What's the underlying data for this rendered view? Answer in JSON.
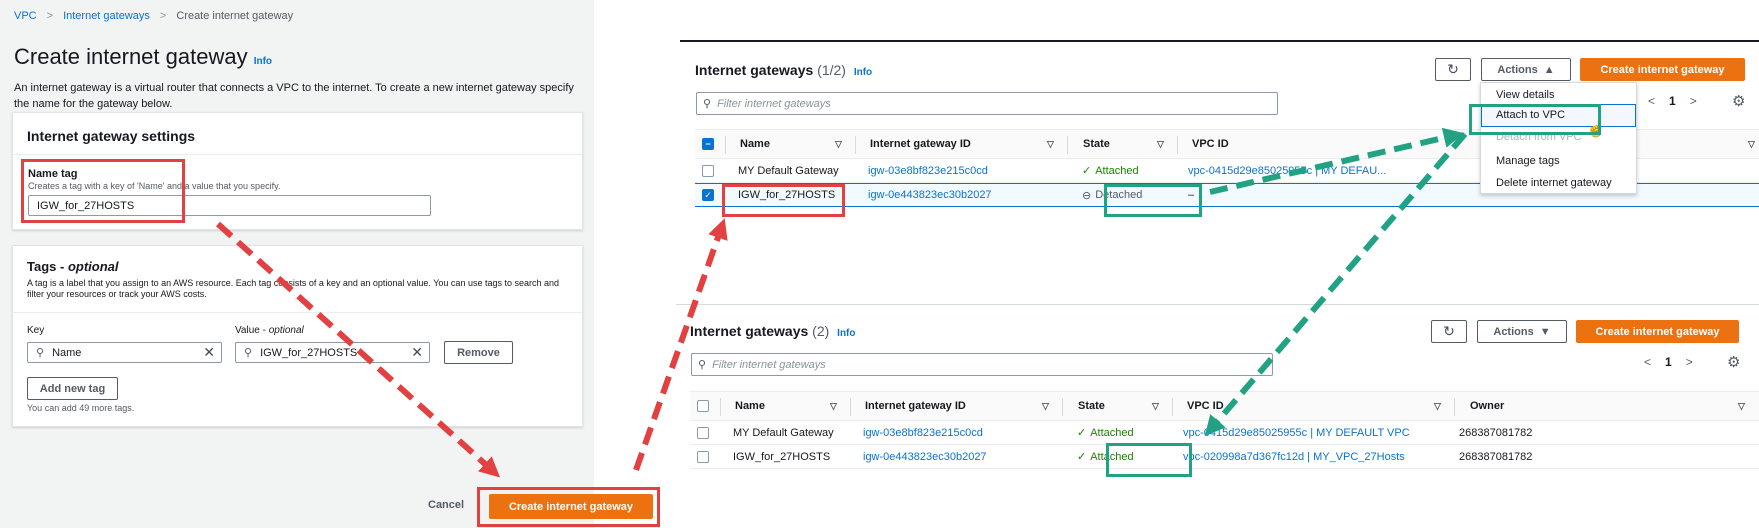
{
  "create_page": {
    "breadcrumb": [
      "VPC",
      "Internet gateways",
      "Create internet gateway"
    ],
    "title": "Create internet gateway",
    "info": "Info",
    "description": "An internet gateway is a virtual router that connects a VPC to the internet. To create a new internet gateway specify the name for the gateway below.",
    "settings": {
      "title": "Internet gateway settings",
      "name_tag_label": "Name tag",
      "name_tag_hint": "Creates a tag with a key of 'Name' and a value that you specify.",
      "name_tag_value": "IGW_for_27HOSTS"
    },
    "tags": {
      "title_prefix": "Tags - ",
      "title_optional": "optional",
      "description": "A tag is a label that you assign to an AWS resource. Each tag consists of a key and an optional value. You can use tags to search and filter your resources or track your AWS costs.",
      "key_label": "Key",
      "value_label_prefix": "Value - ",
      "value_label_optional": "optional",
      "key_value": "Name",
      "value_value": "IGW_for_27HOSTS",
      "remove_label": "Remove",
      "add_label": "Add new tag",
      "remaining": "You can add 49 more tags."
    },
    "cancel_label": "Cancel",
    "create_label": "Create internet gateway"
  },
  "list_before": {
    "title": "Internet gateways",
    "count": "(1/2)",
    "info": "Info",
    "actions_label": "Actions",
    "create_label": "Create internet gateway",
    "search_placeholder": "Filter internet gateways",
    "page": "1",
    "columns": [
      "Name",
      "Internet gateway ID",
      "State",
      "VPC ID"
    ],
    "rows": [
      {
        "name": "MY Default Gateway",
        "id": "igw-03e8bf823e215c0cd",
        "state": "Attached",
        "vpc": "vpc-0415d29e85025955c | MY DEFAU..."
      },
      {
        "name": "IGW_for_27HOSTS",
        "id": "igw-0e443823ec30b2027",
        "state": "Detached",
        "vpc": "–"
      }
    ],
    "menu": [
      "View details",
      "Attach to VPC",
      "Detach from VPC",
      "Manage tags",
      "Delete internet gateway"
    ]
  },
  "list_after": {
    "title": "Internet gateways",
    "count": "(2)",
    "info": "Info",
    "actions_label": "Actions",
    "create_label": "Create internet gateway",
    "search_placeholder": "Filter internet gateways",
    "page": "1",
    "columns": [
      "Name",
      "Internet gateway ID",
      "State",
      "VPC ID",
      "Owner"
    ],
    "rows": [
      {
        "name": "MY Default Gateway",
        "id": "igw-03e8bf823e215c0cd",
        "state": "Attached",
        "vpc": "vpc-0415d29e85025955c | MY DEFAULT VPC",
        "owner": "268387081782"
      },
      {
        "name": "IGW_for_27HOSTS",
        "id": "igw-0e443823ec30b2027",
        "state": "Attached",
        "vpc": "vpc-020998a7d367fc12d | MY_VPC_27Hosts",
        "owner": "268387081782"
      }
    ]
  },
  "colors": {
    "annotation_red": "#e34141",
    "annotation_green": "#21a283",
    "primary": "#ec7211",
    "link": "#0972d3"
  }
}
